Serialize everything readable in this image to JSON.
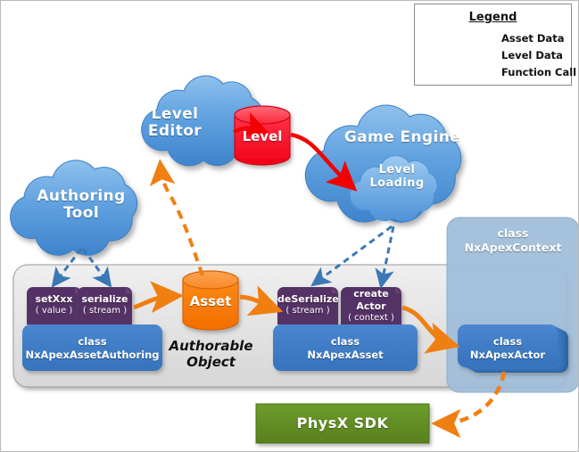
{
  "legend": {
    "title": "Legend",
    "items": [
      {
        "label": "Asset Data",
        "style": "solid",
        "color": "#F07F12",
        "icon": "arrow-right-icon"
      },
      {
        "label": "Level Data",
        "style": "solid",
        "color": "#F40000",
        "icon": "arrow-right-icon"
      },
      {
        "label": "Function Call",
        "style": "dashed",
        "color": "#3B78B6",
        "icon": "dashed-arrow-right-icon"
      }
    ]
  },
  "clouds": {
    "level_editor": "Level\nEditor",
    "authoring_tool": "Authoring\nTool",
    "game_engine": "Game Engine",
    "level_loading": "Level\nLoading"
  },
  "cylinders": {
    "level": "Level",
    "asset": "Asset"
  },
  "authorable_object": "Authorable\nObject",
  "methods": [
    {
      "name": "setXxx",
      "arg": "( value )"
    },
    {
      "name": "serialize",
      "arg": "( stream )"
    },
    {
      "name": "deSerialize",
      "arg": "( stream )"
    },
    {
      "name": "create\nActor",
      "arg": "( context )"
    }
  ],
  "classes": {
    "authoring": "class\nNxApexAssetAuthoring",
    "asset": "class\nNxApexAsset",
    "actor": "class\nNxApexActor",
    "context": "class\nNxApexContext"
  },
  "sdk": "PhysX SDK",
  "colors": {
    "asset_data": "#F07F12",
    "level_data": "#F40000",
    "function_call": "#3B78B6",
    "cloud_blue": "#4A90D9",
    "cylinder_orange": "#F97306",
    "cylinder_red": "#FA1E32",
    "method_purple": "#553066",
    "class_blue": "#3D7CC9",
    "context_panel": "#9FBCD8",
    "sdk_green": "#5F9024",
    "band_gray": "#E9E9E9"
  }
}
